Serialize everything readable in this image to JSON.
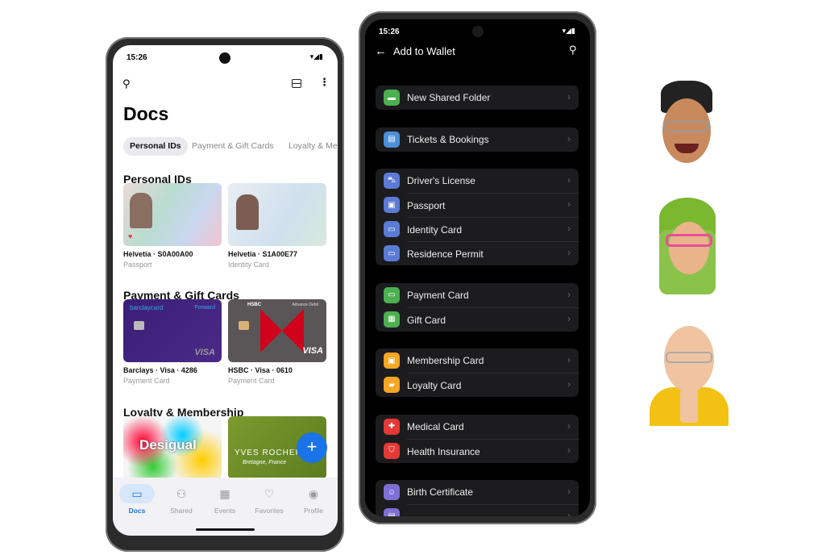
{
  "left_screen": {
    "status": {
      "time": "15:26"
    },
    "title": "Docs",
    "chips": [
      {
        "label": "Personal IDs",
        "active": true
      },
      {
        "label": "Payment & Gift Cards"
      },
      {
        "label": "Loyalty & Me"
      }
    ],
    "sections": [
      {
        "heading": "Personal IDs",
        "cards": [
          {
            "title": "Helvetia · S0A00A00",
            "subtitle": "Passport"
          },
          {
            "title": "Helvetia · S1A00E77",
            "subtitle": "Identity Card"
          }
        ]
      },
      {
        "heading": "Payment & Gift Cards",
        "cards": [
          {
            "title": "Barclays · Visa · 4286",
            "subtitle": "Payment Card",
            "brand": "barclaycard",
            "tier": "Forward",
            "network": "VISA"
          },
          {
            "title": "HSBC · Visa · 0610",
            "subtitle": "Payment Card",
            "brand": "HSBC",
            "tier": "Advance Debit",
            "network": "VISA"
          }
        ]
      },
      {
        "heading": "Loyalty & Membership",
        "cards": [
          {
            "brand": "Desigual"
          },
          {
            "brand": "YVES ROCHER",
            "tagline": "Bretagne, France"
          }
        ]
      }
    ],
    "fab_icon": "plus-icon",
    "fab_color": "#1a73e8",
    "nav": [
      {
        "label": "Docs",
        "icon": "docs-icon",
        "active": true
      },
      {
        "label": "Shared",
        "icon": "shared-icon"
      },
      {
        "label": "Events",
        "icon": "calendar-icon"
      },
      {
        "label": "Favorites",
        "icon": "heart-icon"
      },
      {
        "label": "Profile",
        "icon": "profile-icon"
      }
    ]
  },
  "right_screen": {
    "status": {
      "time": "15:26"
    },
    "title": "Add to Wallet",
    "groups": [
      [
        {
          "label": "New Shared Folder",
          "icon": "folder-icon",
          "color": "#4caf50"
        }
      ],
      [
        {
          "label": "Tickets & Bookings",
          "icon": "ticket-icon",
          "color": "#4a90d9"
        }
      ],
      [
        {
          "label": "Driver's License",
          "icon": "car-icon",
          "color": "#5b7bd5"
        },
        {
          "label": "Passport",
          "icon": "passport-icon",
          "color": "#5b7bd5"
        },
        {
          "label": "Identity Card",
          "icon": "id-card-icon",
          "color": "#5b7bd5"
        },
        {
          "label": "Residence Permit",
          "icon": "id-card-icon",
          "color": "#5b7bd5"
        }
      ],
      [
        {
          "label": "Payment Card",
          "icon": "credit-card-icon",
          "color": "#4caf50"
        },
        {
          "label": "Gift Card",
          "icon": "gift-icon",
          "color": "#4caf50"
        }
      ],
      [
        {
          "label": "Membership Card",
          "icon": "badge-icon",
          "color": "#f5a623"
        },
        {
          "label": "Loyalty Card",
          "icon": "shopping-bag-icon",
          "color": "#f5a623"
        }
      ],
      [
        {
          "label": "Medical Card",
          "icon": "medical-icon",
          "color": "#e53935"
        },
        {
          "label": "Health Insurance",
          "icon": "shield-icon",
          "color": "#e53935"
        }
      ],
      [
        {
          "label": "Birth Certificate",
          "icon": "baby-icon",
          "color": "#7e6fd6"
        },
        {
          "label": "",
          "icon": "document-icon",
          "color": "#7e6fd6"
        }
      ]
    ]
  }
}
